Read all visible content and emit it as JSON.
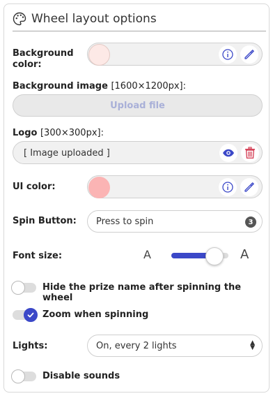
{
  "header": {
    "title": "Wheel layout options"
  },
  "background_color": {
    "label": "Background color:",
    "swatch_color": "#fde9e6"
  },
  "background_image": {
    "label": "Background image",
    "size_hint": "[1600×1200px]:",
    "upload_label": "Upload file"
  },
  "logo": {
    "label": "Logo",
    "size_hint": "[300×300px]:",
    "value": "[ Image uploaded ]"
  },
  "ui_color": {
    "label": "UI color:",
    "swatch_color": "#fbb4b4"
  },
  "spin_button": {
    "label": "Spin Button:",
    "value": "Press to spin",
    "char_count": "3"
  },
  "font_size": {
    "label": "Font size:",
    "small_glyph": "A",
    "large_glyph": "A",
    "level_fraction": 0.75
  },
  "hide_prize": {
    "label": "Hide the prize name after spinning the wheel",
    "enabled": false
  },
  "zoom": {
    "label": "Zoom when spinning",
    "enabled": true
  },
  "lights": {
    "label": "Lights:",
    "value": "On, every 2 lights"
  },
  "sounds": {
    "label": "Disable sounds",
    "enabled": false
  },
  "colors": {
    "accent": "#3b48c8",
    "danger": "#d6455b",
    "info": "#3b48c8"
  },
  "icons": [
    "palette-icon",
    "info-icon",
    "pencil-icon",
    "eye-icon",
    "trash-icon",
    "check-icon",
    "select-arrows-icon"
  ]
}
